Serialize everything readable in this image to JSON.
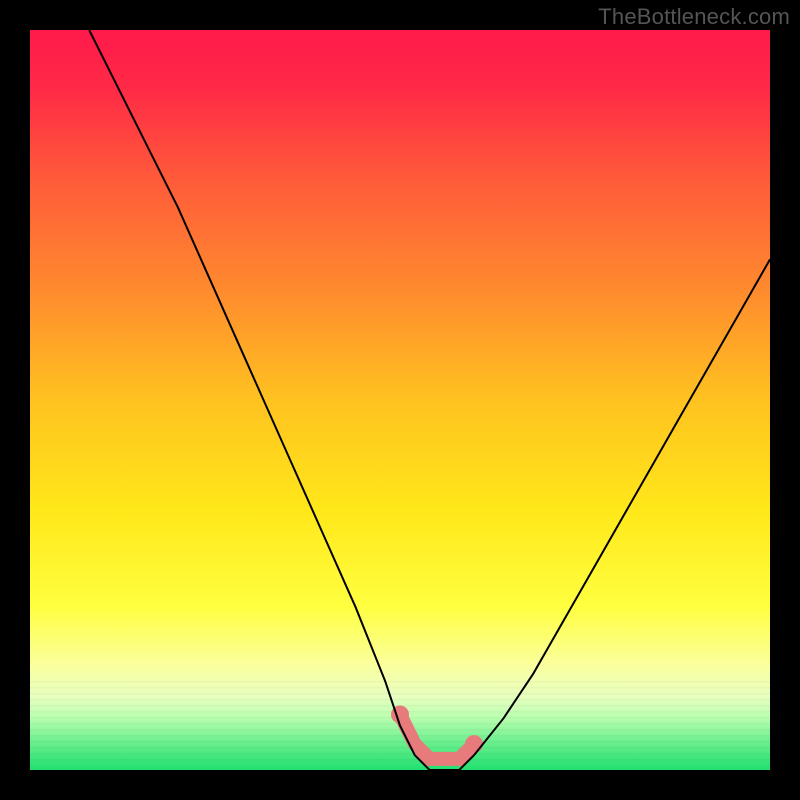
{
  "watermark": "TheBottleneck.com",
  "chart_data": {
    "type": "line",
    "title": "",
    "xlabel": "",
    "ylabel": "",
    "xlim": [
      0,
      100
    ],
    "ylim": [
      0,
      100
    ],
    "curve": {
      "description": "Bottleneck percentage curve (V-shape). y≈0 at optimal match.",
      "x": [
        8,
        12,
        16,
        20,
        24,
        28,
        32,
        36,
        40,
        44,
        48,
        50,
        52,
        54,
        56,
        58,
        60,
        64,
        68,
        72,
        76,
        80,
        84,
        88,
        92,
        96,
        100
      ],
      "y": [
        100,
        92,
        84,
        76,
        67,
        58,
        49,
        40,
        31,
        22,
        12,
        6,
        2,
        0,
        0,
        0,
        2,
        7,
        13,
        20,
        27,
        34,
        41,
        48,
        55,
        62,
        69
      ]
    },
    "optimal_band": {
      "description": "Highlighted near-zero bottleneck region",
      "x_start": 50,
      "x_end": 62,
      "color": "#e77b7b"
    },
    "background_gradient": {
      "stops": [
        {
          "offset": 0.0,
          "color": "#ff1a4b"
        },
        {
          "offset": 0.08,
          "color": "#ff2a46"
        },
        {
          "offset": 0.2,
          "color": "#ff5a3a"
        },
        {
          "offset": 0.35,
          "color": "#ff8a2e"
        },
        {
          "offset": 0.5,
          "color": "#ffc220"
        },
        {
          "offset": 0.65,
          "color": "#ffe81a"
        },
        {
          "offset": 0.78,
          "color": "#ffff40"
        },
        {
          "offset": 0.86,
          "color": "#faffa0"
        },
        {
          "offset": 0.9,
          "color": "#e8ffc0"
        },
        {
          "offset": 0.93,
          "color": "#b8ffb0"
        },
        {
          "offset": 0.96,
          "color": "#70f090"
        },
        {
          "offset": 1.0,
          "color": "#20e070"
        }
      ]
    }
  }
}
